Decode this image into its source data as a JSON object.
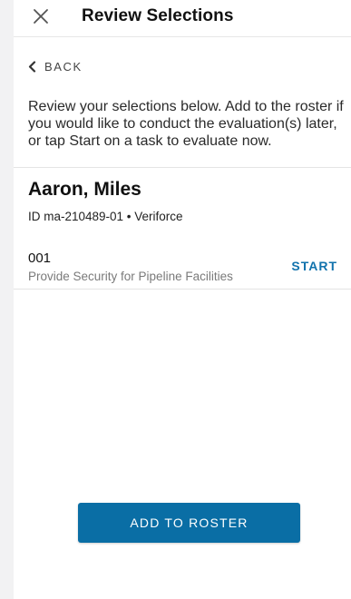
{
  "header": {
    "title": "Review Selections",
    "close_icon": "close-icon"
  },
  "back": {
    "label": "BACK",
    "icon": "chevron-left-icon"
  },
  "instructions": "Review your selections below. Add to the roster if you would like to conduct the evaluation(s) later, or tap Start on a task to evaluate now.",
  "person": {
    "name": "Aaron, Miles",
    "meta": "ID ma-210489-01 • Veriforce"
  },
  "tasks": [
    {
      "code": "001",
      "description": "Provide Security for Pipeline Facilities",
      "action": "START"
    }
  ],
  "footer": {
    "roster_button": "ADD TO ROSTER"
  },
  "colors": {
    "accent": "#0a6ea5",
    "link": "#1273ad",
    "background": "#f2f2f3"
  }
}
